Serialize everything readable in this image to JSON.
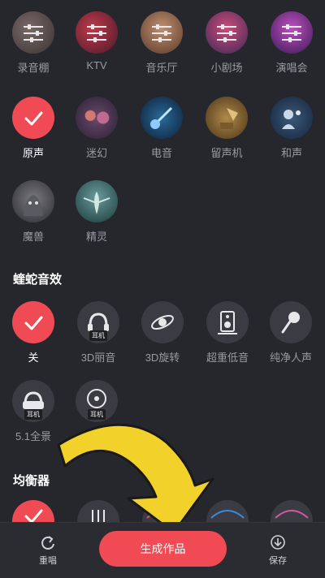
{
  "scenes": {
    "items": [
      {
        "label": "录音棚"
      },
      {
        "label": "KTV"
      },
      {
        "label": "音乐厅"
      },
      {
        "label": "小剧场"
      },
      {
        "label": "演唱会"
      },
      {
        "label": "原声",
        "selected": true
      },
      {
        "label": "迷幻"
      },
      {
        "label": "电音"
      },
      {
        "label": "留声机"
      },
      {
        "label": "和声"
      },
      {
        "label": "魔兽"
      },
      {
        "label": "精灵"
      }
    ]
  },
  "viper": {
    "title": "蝰蛇音效",
    "items": [
      {
        "label": "关",
        "selected": true
      },
      {
        "label": "3D丽音",
        "badge": "耳机"
      },
      {
        "label": "3D旋转"
      },
      {
        "label": "超重低音"
      },
      {
        "label": "纯净人声"
      },
      {
        "label": "5.1全景",
        "badge": "耳机"
      },
      {
        "badge": "耳机"
      }
    ]
  },
  "equalizer": {
    "title": "均衡器"
  },
  "bottom": {
    "reset_label": "重唱",
    "generate_label": "生成作品",
    "save_label": "保存"
  },
  "colors": {
    "accent": "#f04b55",
    "background": "#26262d",
    "arrow": "#f2d22a"
  }
}
